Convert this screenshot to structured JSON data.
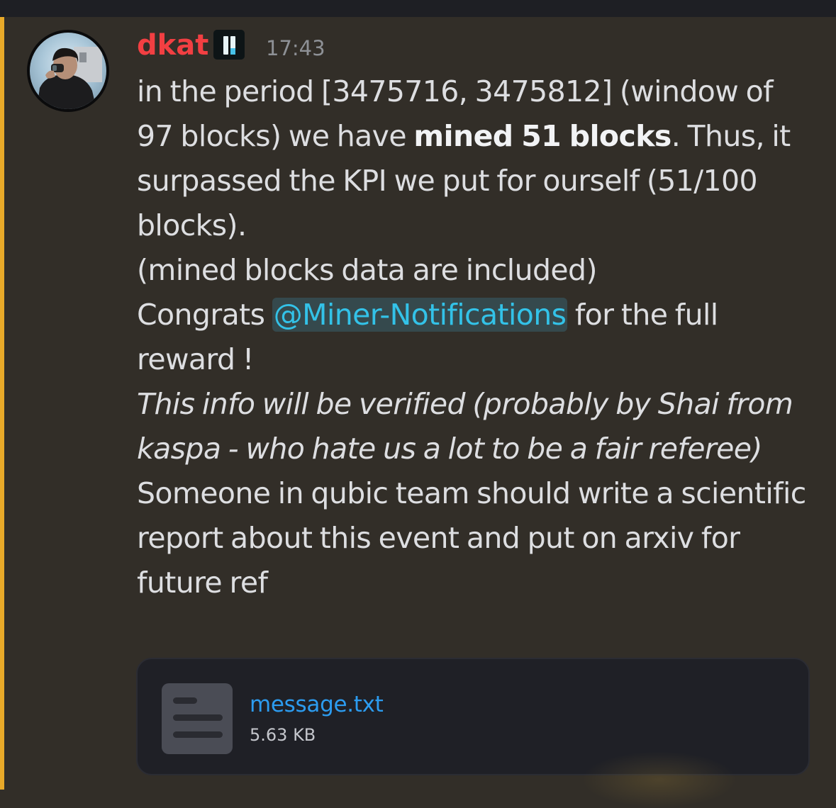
{
  "colors": {
    "background": "#322e28",
    "accent_bar": "#e8a929",
    "username": "#f23f42",
    "mention": "#33c2e8",
    "file_link": "#2c9cf0"
  },
  "message": {
    "author": "dkat",
    "tag_icon": "role-badge-icon",
    "timestamp": "17:43",
    "line1_a": "in the period [3475716, 3475812] (window of 97 blocks) we have ",
    "line1_bold": "mined 51 blocks",
    "line1_b": ". Thus, it surpassed the KPI we put for ourself (51/100 blocks).",
    "line2": "(mined blocks data are included)",
    "line3_a": "Congrats ",
    "mention": "@Miner-Notifications",
    "line3_b": " for the full reward !",
    "italic": "This info will be verified (probably by Shai from kaspa - who hate us a lot to be a fair referee)",
    "line4": "Someone in qubic team should write a scientific report about this event and put on arxiv for future ref"
  },
  "attachment": {
    "icon": "text-file-icon",
    "file_name": "message.txt",
    "file_size": "5.63 KB"
  }
}
